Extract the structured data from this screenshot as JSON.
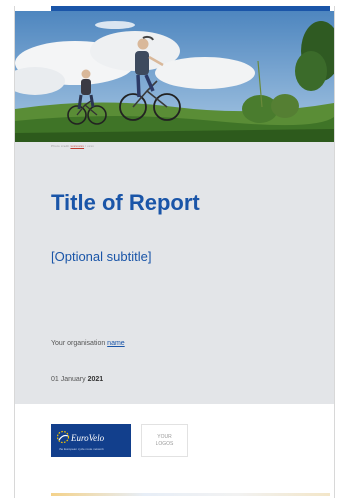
{
  "hero": {
    "caption_left": "Photo credit ",
    "caption_mid": "xxxxxxxx",
    "caption_right": " / xxxx"
  },
  "report": {
    "title": "Title of Report",
    "subtitle": "[Optional subtitle]",
    "org_prefix": "Your organisation ",
    "org_link": "name",
    "date_day": "01 January ",
    "date_year": "2021"
  },
  "logos": {
    "eurovelo_name": "EuroVelo",
    "eurovelo_tagline": "the European cycle route network",
    "placeholder_line1": "YOUR",
    "placeholder_line2": "LOGOS"
  },
  "colors": {
    "accent": "#1a55a8",
    "panel": "#e3e5e8",
    "logo_bg": "#123f8c"
  }
}
